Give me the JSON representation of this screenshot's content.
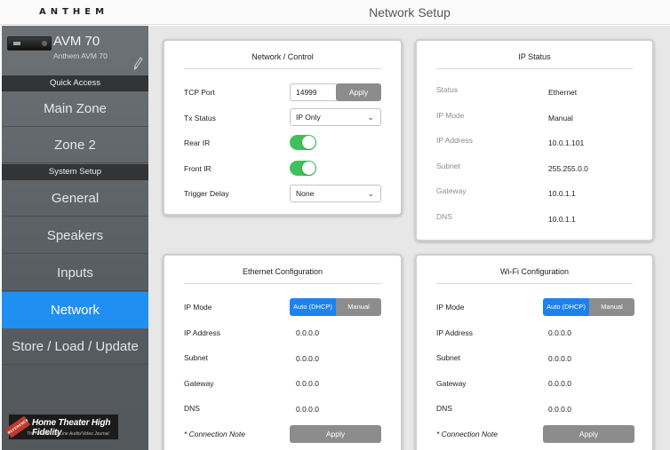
{
  "header": {
    "brand": "ANTHEM",
    "title": "Network Setup"
  },
  "device": {
    "name": "AVM 70",
    "subtitle": "Anthem AVM 70",
    "edit_icon": "pencil-icon"
  },
  "sidebar": {
    "quick_access": "Quick Access",
    "system_setup": "System Setup",
    "items": [
      {
        "label": "Main Zone"
      },
      {
        "label": "Zone 2"
      },
      {
        "label": "General"
      },
      {
        "label": "Speakers"
      },
      {
        "label": "Inputs"
      },
      {
        "label": "Network"
      },
      {
        "label": "Store / Load / Update"
      }
    ],
    "active_color": "#1f8ff2"
  },
  "watermark": {
    "title": "Home Theater High Fidelity",
    "tagline": "The Premier On-Line Audio/Video Journal",
    "stamp": "REFERENCE"
  },
  "network_control": {
    "title": "Network / Control",
    "tcp_port_label": "TCP Port",
    "tcp_port_value": "14999",
    "apply_label": "Apply",
    "tx_status_label": "Tx Status",
    "tx_status_value": "IP Only",
    "rear_ir_label": "Rear IR",
    "rear_ir_on": true,
    "front_ir_label": "Front IR",
    "front_ir_on": true,
    "trigger_delay_label": "Trigger Delay",
    "trigger_delay_value": "None",
    "toggle_color": "#40c05a"
  },
  "ip_status": {
    "title": "IP Status",
    "rows": [
      {
        "label": "Status",
        "value": "Ethernet"
      },
      {
        "label": "IP Mode",
        "value": "Manual"
      },
      {
        "label": "IP Address",
        "value": "10.0.1.101"
      },
      {
        "label": "Subnet",
        "value": "255.255.0.0"
      },
      {
        "label": "Gateway",
        "value": "10.0.1.1"
      },
      {
        "label": "DNS",
        "value": "10.0.1.1"
      }
    ]
  },
  "ethernet": {
    "title": "Ethernet Configuration",
    "ip_mode_label": "IP Mode",
    "mode_auto": "Auto (DHCP)",
    "mode_manual": "Manual",
    "ip_address_label": "IP Address",
    "ip_address": "0.0.0.0",
    "subnet_label": "Subnet",
    "subnet": "0.0.0.0",
    "gateway_label": "Gateway",
    "gateway": "0.0.0.0",
    "dns_label": "DNS",
    "dns": "0.0.0.0",
    "note": "* Connection Note",
    "apply_label": "Apply"
  },
  "wifi": {
    "title": "Wi-Fi Configuration",
    "ip_mode_label": "IP Mode",
    "mode_auto": "Auto (DHCP)",
    "mode_manual": "Manual",
    "ip_address_label": "IP Address",
    "ip_address": "0.0.0.0",
    "subnet_label": "Subnet",
    "subnet": "0.0.0.0",
    "gateway_label": "Gateway",
    "gateway": "0.0.0.0",
    "dns_label": "DNS",
    "dns": "0.0.0.0",
    "note": "* Connection Note",
    "apply_label": "Apply"
  }
}
